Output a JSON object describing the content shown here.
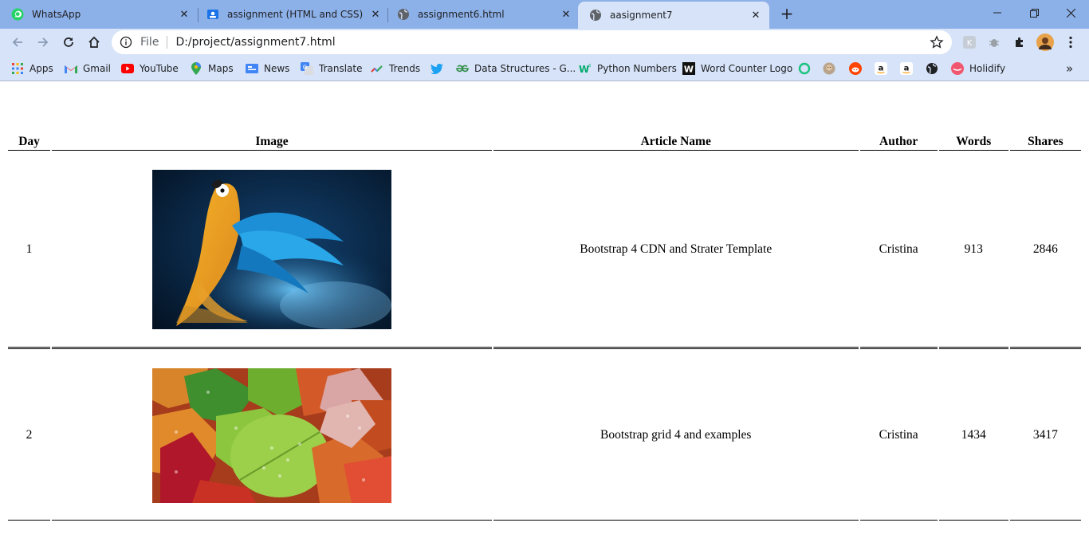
{
  "browser": {
    "tabs": [
      {
        "title": "WhatsApp",
        "icon": "whatsapp-icon",
        "active": false
      },
      {
        "title": "assignment (HTML and CSS)",
        "icon": "classroom-icon",
        "active": false
      },
      {
        "title": "assignment6.html",
        "icon": "globe-icon",
        "active": false
      },
      {
        "title": "aasignment7",
        "icon": "globe-icon",
        "active": true
      }
    ],
    "address": {
      "scheme": "File",
      "url": "D:/project/assignment7.html"
    },
    "bookmarks": [
      {
        "label": "Apps",
        "icon": "apps-grid-icon"
      },
      {
        "label": "Gmail",
        "icon": "gmail-icon"
      },
      {
        "label": "YouTube",
        "icon": "youtube-icon"
      },
      {
        "label": "Maps",
        "icon": "maps-pin-icon"
      },
      {
        "label": "News",
        "icon": "news-icon"
      },
      {
        "label": "Translate",
        "icon": "translate-icon"
      },
      {
        "label": "Trends",
        "icon": "trends-icon"
      },
      {
        "label": "",
        "icon": "twitter-icon"
      },
      {
        "label": "Data Structures - G...",
        "icon": "geeksforgeeks-icon"
      },
      {
        "label": "Python Numbers",
        "icon": "w3schools-icon"
      },
      {
        "label": "Word Counter Logo",
        "icon": "word-counter-icon"
      },
      {
        "label": "",
        "icon": "ring-icon"
      },
      {
        "label": "",
        "icon": "face-icon"
      },
      {
        "label": "",
        "icon": "reddit-icon"
      },
      {
        "label": "",
        "icon": "amazon-icon"
      },
      {
        "label": "",
        "icon": "amazon-icon"
      },
      {
        "label": "",
        "icon": "globe-icon"
      },
      {
        "label": "Holidify",
        "icon": "holidify-icon"
      }
    ],
    "more_bookmarks": "»",
    "colors": {
      "frame": "#8cb0e8",
      "toolbar": "#d6e3f8"
    }
  },
  "table": {
    "headers": {
      "day": "Day",
      "image": "Image",
      "article": "Article Name",
      "author": "Author",
      "words": "Words",
      "shares": "Shares"
    },
    "rows": [
      {
        "day": "1",
        "image": "parrot-image",
        "article": "Bootstrap 4 CDN and Strater Template",
        "author": "Cristina",
        "words": "913",
        "shares": "2846"
      },
      {
        "day": "2",
        "image": "autumn-leaves-image",
        "article": "Bootstrap grid 4 and examples",
        "author": "Cristina",
        "words": "1434",
        "shares": "3417"
      }
    ]
  }
}
